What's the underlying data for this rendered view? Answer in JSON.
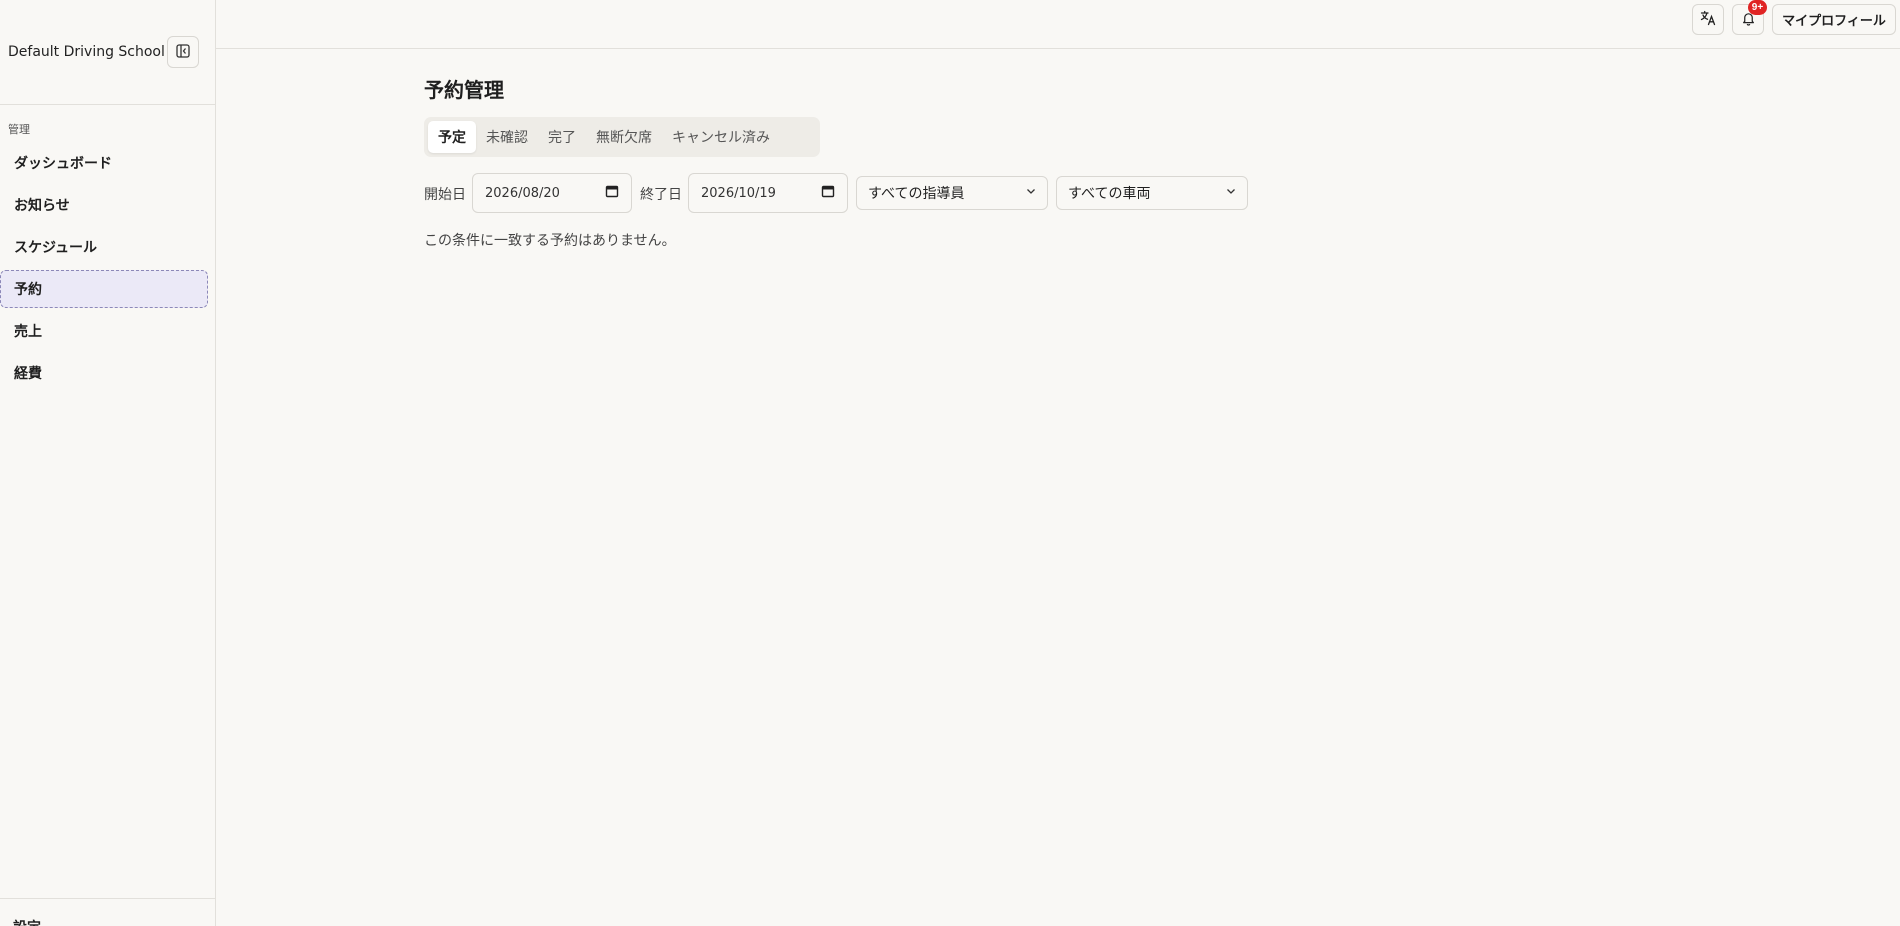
{
  "sidebar": {
    "school_name": "Default Driving School",
    "section_label": "管理",
    "items": [
      {
        "label": "ダッシュボード"
      },
      {
        "label": "お知らせ"
      },
      {
        "label": "スケジュール"
      },
      {
        "label": "予約"
      },
      {
        "label": "売上"
      },
      {
        "label": "経費"
      }
    ],
    "active_item": "予約",
    "footer_label": "設定"
  },
  "topbar": {
    "translate_icon": "translate-icon",
    "bell_icon": "bell-icon",
    "notification_badge": "9+",
    "profile_label": "マイプロフィール"
  },
  "main": {
    "title": "予約管理",
    "tabs": [
      {
        "label": "予定"
      },
      {
        "label": "未確認"
      },
      {
        "label": "完了"
      },
      {
        "label": "無断欠席"
      },
      {
        "label": "キャンセル済み"
      }
    ],
    "active_tab": "予定",
    "filters": {
      "start_label": "開始日",
      "start_value": "2026/08/20",
      "end_label": "終了日",
      "end_value": "2026/10/19",
      "instructor_select": "すべての指導員",
      "vehicle_select": "すべての車両"
    },
    "empty_message": "この条件に一致する予約はありません。"
  },
  "colors": {
    "background": "#f9f8f5",
    "active_nav_bg": "#ebe9f7",
    "badge": "#e02424"
  }
}
